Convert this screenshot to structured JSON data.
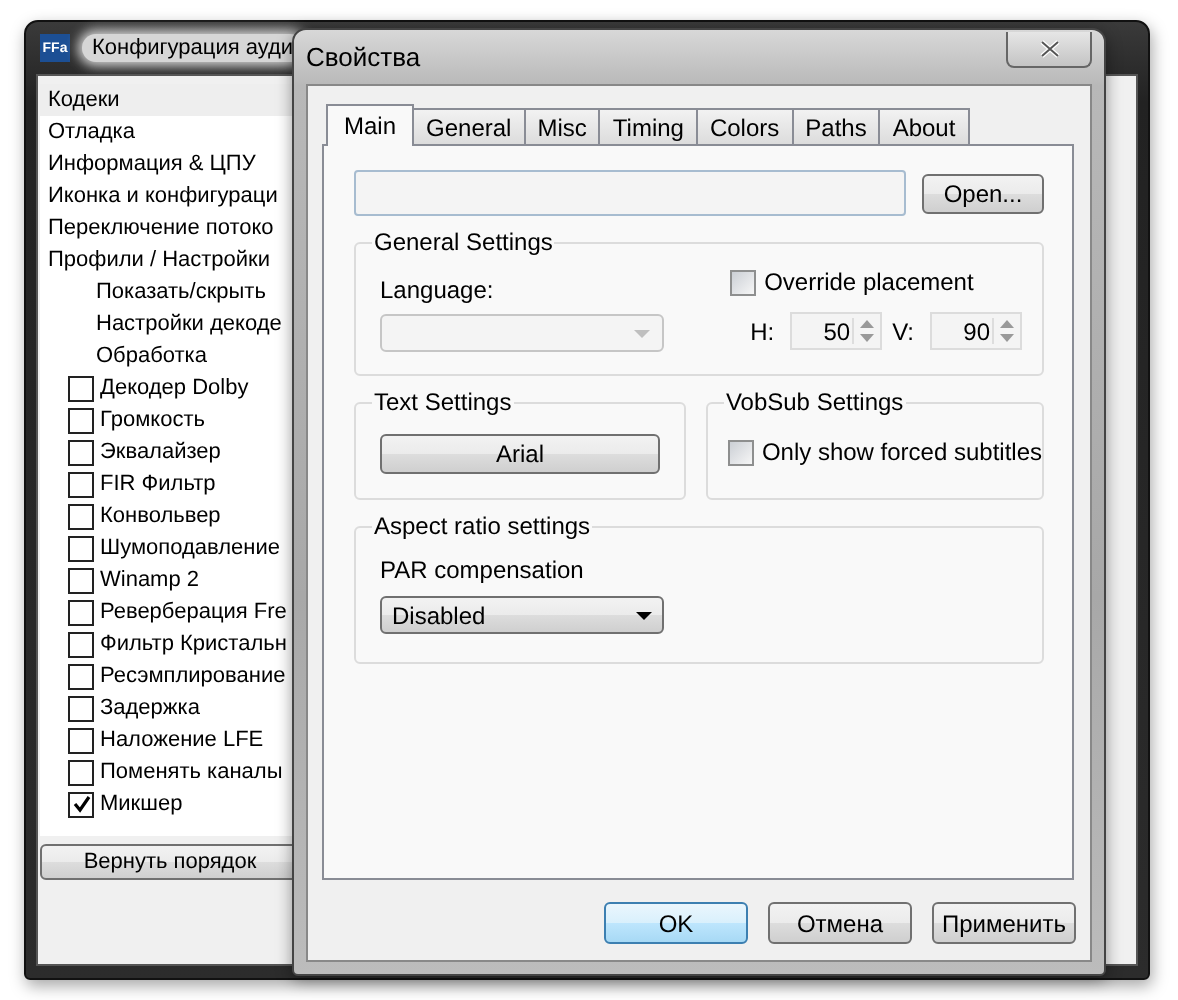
{
  "background_window": {
    "app_icon_label": "FFa",
    "title": "Конфигурация ауди",
    "list": [
      {
        "label": "Кодеки",
        "selected": true
      },
      {
        "label": "Отладка",
        "selected": false
      },
      {
        "label": "Информация & ЦПУ",
        "selected": false
      },
      {
        "label": "Иконка и конфигураци",
        "selected": false
      },
      {
        "label": "Переключение потоко",
        "selected": false
      },
      {
        "label": "Профили / Настройки",
        "selected": false,
        "children": [
          {
            "kind": "item",
            "label": "Показать/скрыть",
            "selected": false
          },
          {
            "kind": "item",
            "label": "Настройки декоде",
            "selected": false
          },
          {
            "kind": "item",
            "label": "Обработка",
            "selected": false
          },
          {
            "kind": "checkbox",
            "label": "Декодер Dolby",
            "checked": false,
            "selected": false
          },
          {
            "kind": "checkbox",
            "label": "Громкость",
            "checked": false,
            "selected": false
          },
          {
            "kind": "checkbox",
            "label": "Эквалайзер",
            "checked": false,
            "selected": false
          },
          {
            "kind": "checkbox",
            "label": "FIR Фильтр",
            "checked": false,
            "selected": false
          },
          {
            "kind": "checkbox",
            "label": "Конвольвер",
            "checked": false,
            "selected": false
          },
          {
            "kind": "checkbox",
            "label": "Шумоподавление",
            "checked": false,
            "selected": false
          },
          {
            "kind": "checkbox",
            "label": "Winamp 2",
            "checked": false,
            "selected": false
          },
          {
            "kind": "checkbox",
            "label": "Реверберация Fre",
            "checked": false,
            "selected": false
          },
          {
            "kind": "checkbox",
            "label": "Фильтр Кристальн",
            "checked": false,
            "selected": false
          },
          {
            "kind": "checkbox",
            "label": "Ресэмплирование",
            "checked": false,
            "selected": false
          },
          {
            "kind": "checkbox",
            "label": "Задержка",
            "checked": false,
            "selected": false
          },
          {
            "kind": "checkbox",
            "label": "Наложение LFE",
            "checked": false,
            "selected": false
          },
          {
            "kind": "checkbox",
            "label": "Поменять каналы",
            "checked": false,
            "selected": false
          },
          {
            "kind": "checkbox",
            "label": "Микшер",
            "checked": true,
            "selected": false
          }
        ]
      }
    ],
    "button": "Вернуть порядок"
  },
  "dialog": {
    "title": "Свойства",
    "tabs": [
      {
        "label": "Main",
        "selected": true
      },
      {
        "label": "General",
        "selected": false
      },
      {
        "label": "Misc",
        "selected": false
      },
      {
        "label": "Timing",
        "selected": false
      },
      {
        "label": "Colors",
        "selected": false
      },
      {
        "label": "Paths",
        "selected": false
      },
      {
        "label": "About",
        "selected": false
      }
    ],
    "open_button": "Open...",
    "general_settings": {
      "title": "General Settings",
      "language_label": "Language:",
      "language_disabled": true,
      "override": {
        "label": "Override placement",
        "checked": false
      },
      "h_label": "H:",
      "h_value": "50",
      "v_label": "V:",
      "v_value": "90"
    },
    "text_settings": {
      "title": "Text Settings",
      "font_button": "Arial"
    },
    "vobsub_settings": {
      "title": "VobSub Settings",
      "forced": {
        "label": "Only show forced subtitles",
        "checked": false
      }
    },
    "aspect_settings": {
      "title": "Aspect ratio settings",
      "par_label": "PAR compensation",
      "par_value": "Disabled"
    },
    "buttons": [
      {
        "label": "OK",
        "default": true
      },
      {
        "label": "Отмена",
        "default": false
      },
      {
        "label": "Применить",
        "default": false
      }
    ]
  }
}
